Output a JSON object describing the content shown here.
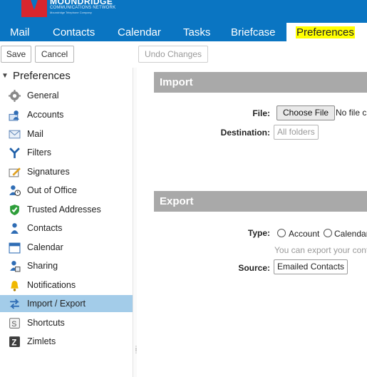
{
  "brand": {
    "name": "MOUNDRIDGE",
    "subtitle": "COMMUNICATIONS NETWORK",
    "tagline": "Moundridge Telephone Company",
    "colors": {
      "header": "#0a75c2",
      "logo": "#d8262e",
      "highlight": "#ffff00",
      "selected_row": "#a3cce9"
    }
  },
  "app_tabs": [
    {
      "label": "Mail",
      "active": false
    },
    {
      "label": "Contacts",
      "active": false
    },
    {
      "label": "Calendar",
      "active": false
    },
    {
      "label": "Tasks",
      "active": false
    },
    {
      "label": "Briefcase",
      "active": false
    },
    {
      "label": "Preferences",
      "active": true
    }
  ],
  "toolbar": {
    "save": "Save",
    "cancel": "Cancel",
    "undo": "Undo Changes"
  },
  "sidebar": {
    "header": "Preferences",
    "items": [
      {
        "label": "General",
        "icon": "gear-icon"
      },
      {
        "label": "Accounts",
        "icon": "accounts-icon"
      },
      {
        "label": "Mail",
        "icon": "mail-envelope-icon"
      },
      {
        "label": "Filters",
        "icon": "filters-icon"
      },
      {
        "label": "Signatures",
        "icon": "signature-pencil-icon"
      },
      {
        "label": "Out of Office",
        "icon": "out-of-office-icon"
      },
      {
        "label": "Trusted Addresses",
        "icon": "shield-check-icon"
      },
      {
        "label": "Contacts",
        "icon": "contact-person-icon"
      },
      {
        "label": "Calendar",
        "icon": "calendar-icon"
      },
      {
        "label": "Sharing",
        "icon": "sharing-icon"
      },
      {
        "label": "Notifications",
        "icon": "bell-icon"
      },
      {
        "label": "Import / Export",
        "icon": "import-export-icon",
        "active": true
      },
      {
        "label": "Shortcuts",
        "icon": "shortcuts-icon"
      },
      {
        "label": "Zimlets",
        "icon": "zimlets-icon"
      }
    ]
  },
  "import": {
    "title": "Import",
    "file_label": "File:",
    "choose_button": "Choose File",
    "no_file": "No file c",
    "destination_label": "Destination:",
    "destination_value": "All folders"
  },
  "export": {
    "title": "Export",
    "type_label": "Type:",
    "option_account": "Account",
    "option_calendar": "Calendar",
    "hint": "You can export your cont",
    "source_label": "Source:",
    "source_value": "Emailed Contacts"
  }
}
